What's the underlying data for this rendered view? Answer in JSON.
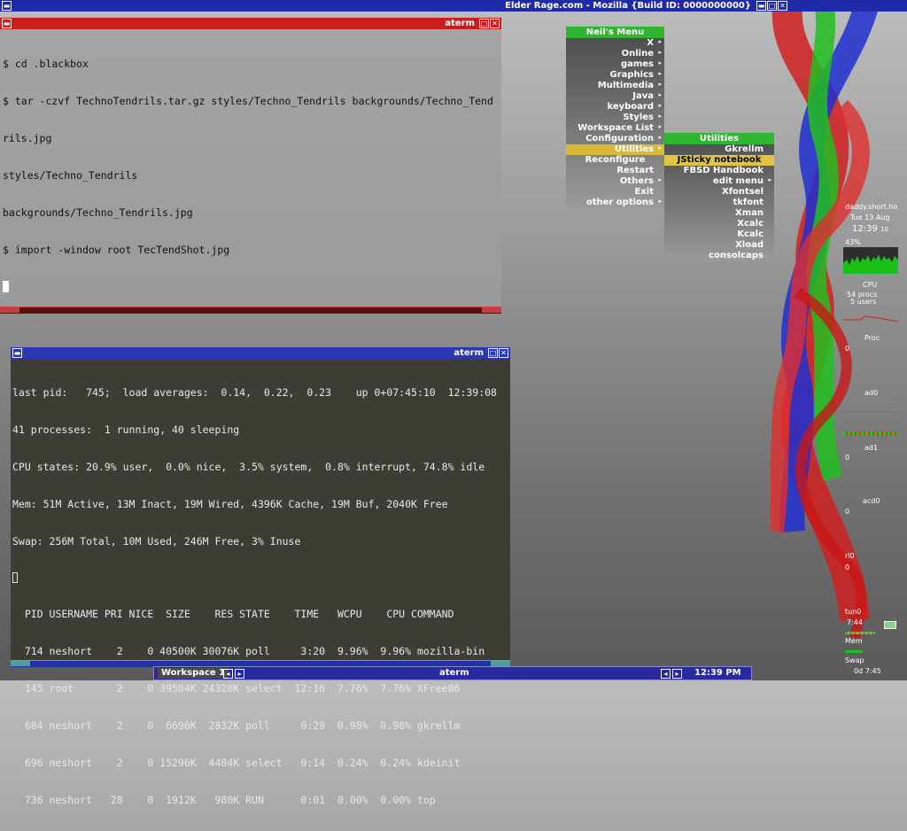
{
  "top_bar": {
    "title": "Elder Rage.com - Mozilla {Build ID: 0000000000}"
  },
  "aterm1": {
    "title": "aterm",
    "lines": [
      "$ cd .blackbox",
      "$ tar -czvf TechnoTendrils.tar.gz styles/Techno_Tendrils backgrounds/Techno_Tend",
      "rils.jpg",
      "styles/Techno_Tendrils",
      "backgrounds/Techno_Tendrils.jpg",
      "$ import -window root TecTendShot.jpg"
    ]
  },
  "aterm2": {
    "title": "aterm",
    "summary": [
      "last pid:   745;  load averages:  0.14,  0.22,  0.23    up 0+07:45:10  12:39:08",
      "41 processes:  1 running, 40 sleeping",
      "CPU states: 20.9% user,  0.0% nice,  3.5% system,  0.8% interrupt, 74.8% idle",
      "Mem: 51M Active, 13M Inact, 19M Wired, 4396K Cache, 19M Buf, 2040K Free",
      "Swap: 256M Total, 10M Used, 246M Free, 3% Inuse"
    ],
    "header": "  PID USERNAME PRI NICE  SIZE    RES STATE    TIME   WCPU    CPU COMMAND",
    "rows": [
      "  714 neshort    2    0 40500K 30076K poll     3:20  9.96%  9.96% mozilla-bin",
      "  145 root       2    0 39584K 24328K select  12:16  7.76%  7.76% XFree86",
      "  684 neshort    2    0  6696K  2832K poll     0:29  0.98%  0.98% gkrellm",
      "  696 neshort    2    0 15296K  4484K select   0:14  0.24%  0.24% kdeinit",
      "  736 neshort   28    0  1912K   980K RUN      0:01  0.00%  0.00% top"
    ]
  },
  "root_menu": {
    "title": "Neil's Menu",
    "items": [
      {
        "label": "X",
        "arrow": "▸"
      },
      {
        "label": "Online",
        "arrow": "▸"
      },
      {
        "label": "games",
        "arrow": "▸"
      },
      {
        "label": "Graphics",
        "arrow": "▸"
      },
      {
        "label": "Multimedia",
        "arrow": "▸"
      },
      {
        "label": "Java",
        "arrow": "▸"
      },
      {
        "label": "keyboard",
        "arrow": "▸"
      },
      {
        "label": "Styles",
        "arrow": "▸"
      },
      {
        "label": "Workspace List",
        "arrow": "▸"
      },
      {
        "label": "Configuration",
        "arrow": "▸"
      },
      {
        "label": "Utilities",
        "arrow": "▸"
      },
      {
        "label": "Reconfigure",
        "arrow": ""
      },
      {
        "label": "Restart",
        "arrow": ""
      },
      {
        "label": "Others",
        "arrow": "▸"
      },
      {
        "label": "Exit",
        "arrow": ""
      },
      {
        "label": "other options",
        "arrow": "▸"
      }
    ]
  },
  "utilities_menu": {
    "title": "Utilities",
    "items": [
      {
        "label": "Gkrellm",
        "arrow": ""
      },
      {
        "label": "JSticky notebook",
        "arrow": ""
      },
      {
        "label": "FBSD Handbook",
        "arrow": ""
      },
      {
        "label": "edit menu",
        "arrow": "▸"
      },
      {
        "label": "Xfontsel",
        "arrow": ""
      },
      {
        "label": "tkfont",
        "arrow": ""
      },
      {
        "label": "Xman",
        "arrow": ""
      },
      {
        "label": "Xcalc",
        "arrow": ""
      },
      {
        "label": "Kcalc",
        "arrow": ""
      },
      {
        "label": "Xload",
        "arrow": ""
      },
      {
        "label": "consolcaps",
        "arrow": ""
      }
    ]
  },
  "gkrellm": {
    "host": "daddy.short.ho",
    "date": "Tue 13 Aug",
    "time": "12:39",
    "ampm": "10",
    "cpu_pct": "43%",
    "cpu_label": "CPU",
    "procs": "54 procs",
    "users": "5 users",
    "proc_label": "Proc",
    "proc_val": "0",
    "ad0_label": "ad0",
    "ad1_label": "ad1",
    "ad1_val": "0",
    "acd0_label": "acd0",
    "acd0_val": "0",
    "rl0_label": "rl0",
    "rl0_val": "0",
    "tun0_label": "tun0",
    "tun0_time": "7:44",
    "mem_label": "Mem",
    "swap_label": "Swap",
    "uptime": "0d 7:45"
  },
  "taskbar": {
    "workspace": "Workspace 1",
    "window": "aterm",
    "clock": "12:39 PM"
  }
}
